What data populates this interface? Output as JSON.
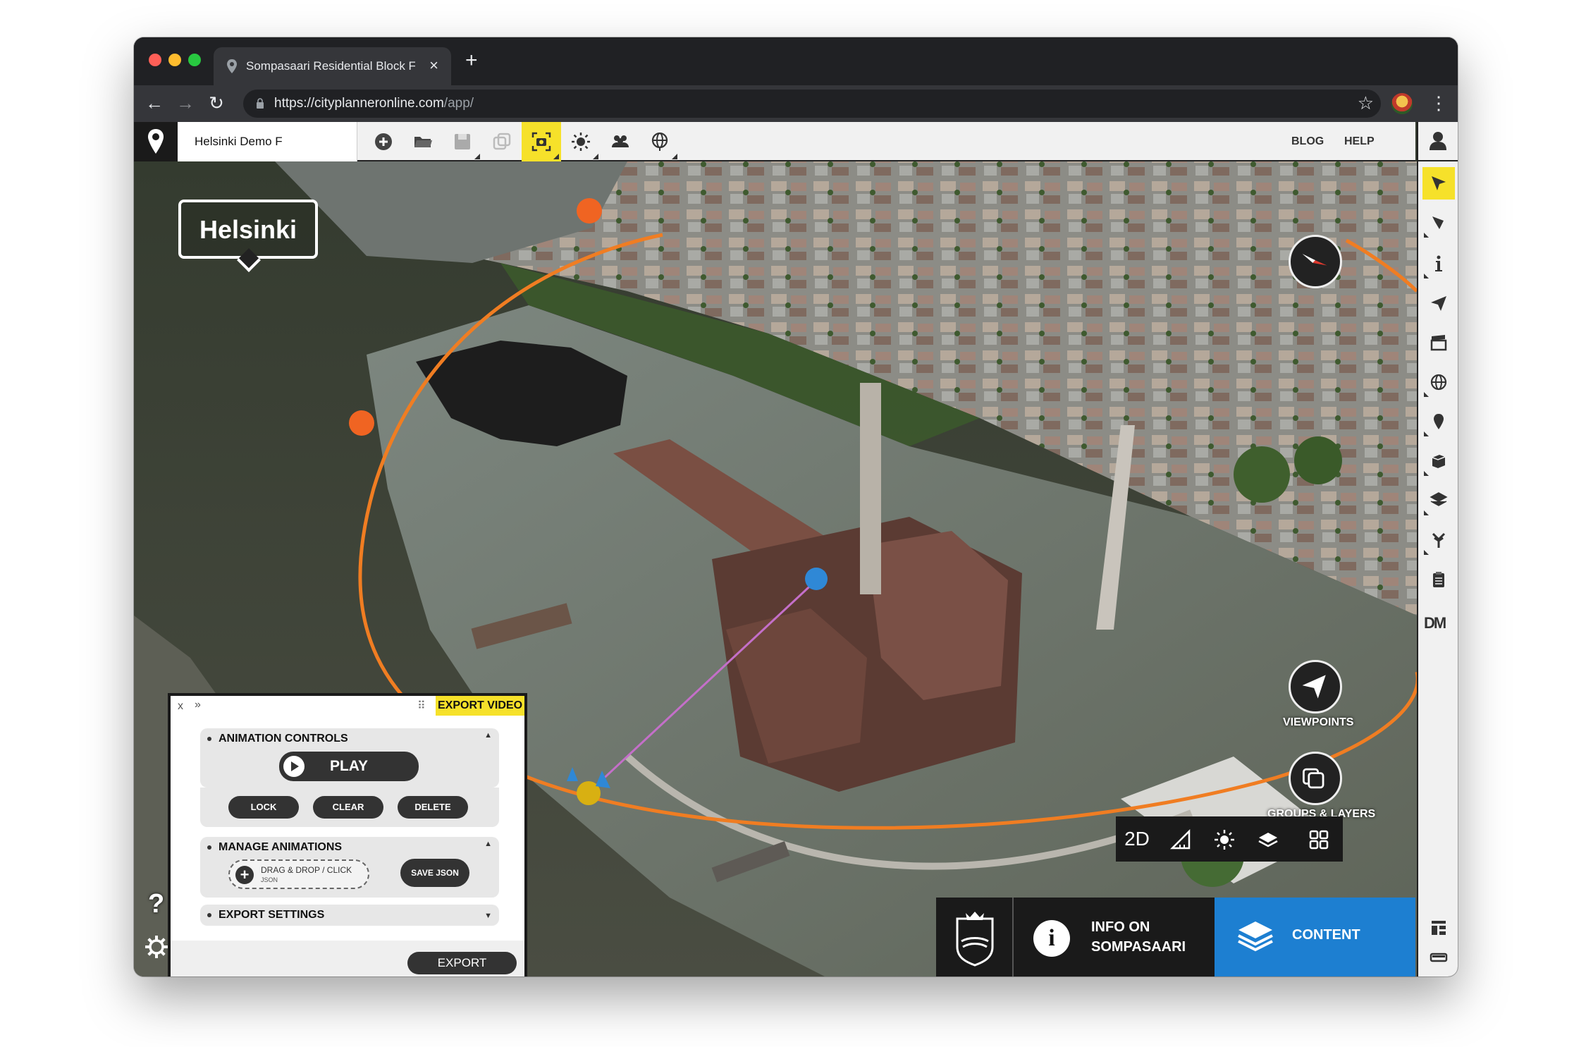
{
  "browser": {
    "tab_title": "Sompasaari Residential Block F",
    "tab_close": "×",
    "new_tab": "+",
    "url_main": "https://cityplanneronline.com",
    "url_path": "/app/",
    "back": "←",
    "forward": "→",
    "reload": "↻",
    "star": "☆",
    "menu": "⋮"
  },
  "app": {
    "project_name": "Helsinki Demo F",
    "top_links": [
      "BLOG",
      "HELP"
    ],
    "toolbar_icons": [
      "add-icon",
      "open-folder-icon",
      "save-icon",
      "copy-icon",
      "camera-capture-icon",
      "sun-icon",
      "users-icon",
      "globe-icon"
    ],
    "active_tool": "camera-capture-icon",
    "accent_color": "#f6e12a",
    "content_color": "#1d7fd1"
  },
  "map": {
    "city_label": "Helsinki",
    "viewpoints_label": "VIEWPOINTS",
    "groups_label": "GROUPS & LAYERS",
    "help": "?",
    "view_2d": "2D",
    "path_color": "#f07d22"
  },
  "rail": {
    "icons": [
      "select-arrow-icon",
      "pen-tool-icon",
      "info-icon",
      "send-icon",
      "clapper-icon",
      "globe-icon",
      "pin-icon",
      "cube-icon",
      "img-icon",
      "tree-icon",
      "clipboard-icon"
    ],
    "dm": "DM"
  },
  "bottom": {
    "info_line1": "INFO ON",
    "info_line2": "SOMPASAARI",
    "info_letter": "i",
    "content": "CONTENT"
  },
  "panel": {
    "close": "x",
    "collapse": "»",
    "grip": "⠿",
    "title": "EXPORT VIDEO",
    "animation_controls": "ANIMATION CONTROLS",
    "play": "PLAY",
    "lock": "LOCK",
    "clear": "CLEAR",
    "delete": "DELETE",
    "manage_animations": "MANAGE ANIMATIONS",
    "drop_text": "DRAG & DROP / CLICK",
    "drop_sub": "JSON",
    "drop_plus": "+",
    "save_json": "SAVE JSON",
    "export_settings": "EXPORT SETTINGS",
    "export": "EXPORT",
    "caret_up": "▲",
    "caret_down": "▼"
  }
}
